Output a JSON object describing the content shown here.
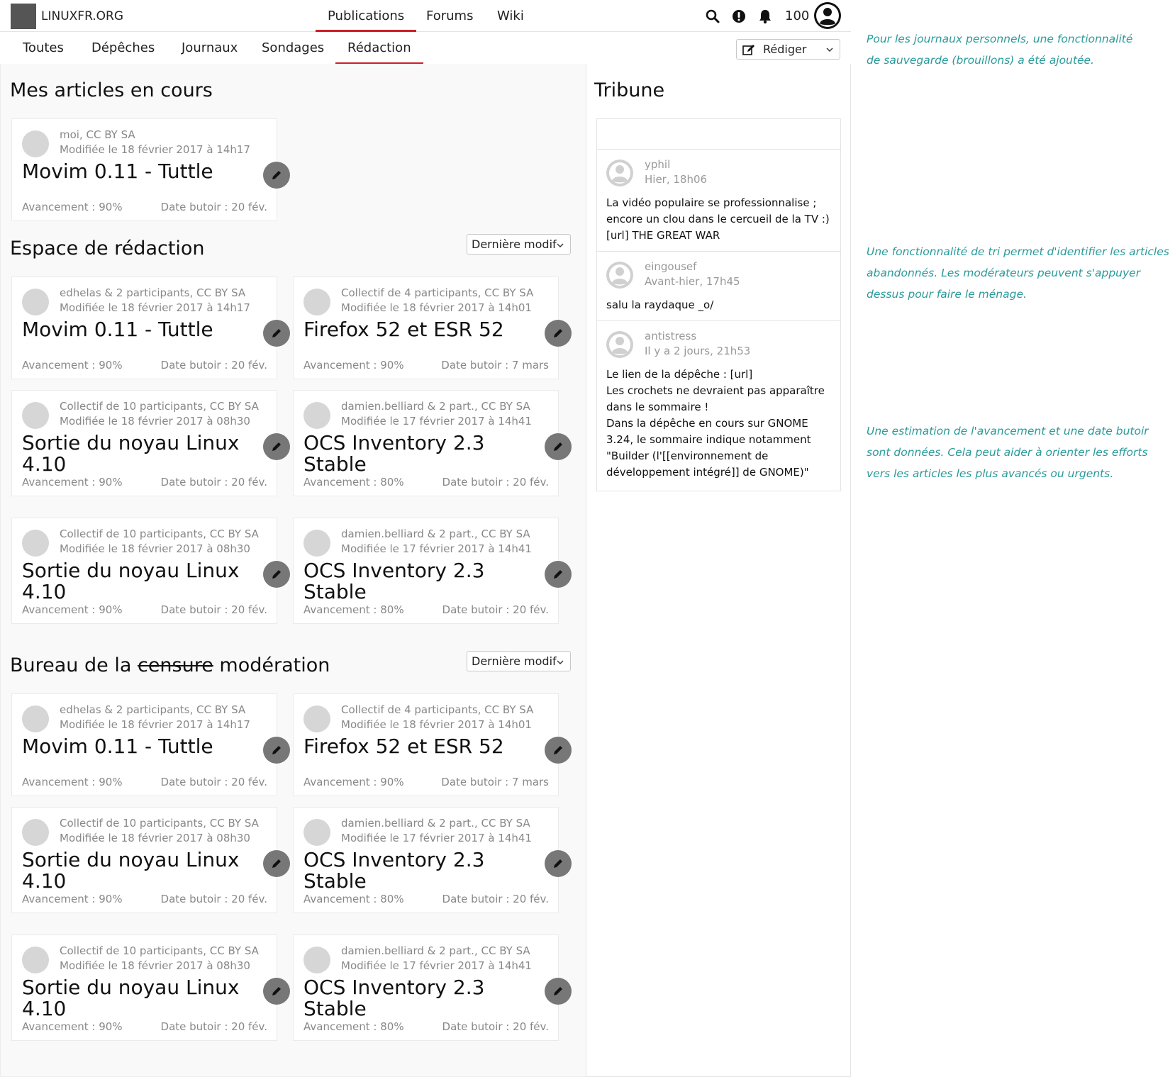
{
  "site": {
    "name": "LINUXFR.ORG"
  },
  "mainnav": [
    {
      "label": "Publications",
      "active": true
    },
    {
      "label": "Forums",
      "active": false
    },
    {
      "label": "Wiki",
      "active": false
    }
  ],
  "toolbar": {
    "score": "100",
    "icons": [
      "search-icon",
      "alert-icon",
      "bell-icon",
      "user-avatar-icon"
    ]
  },
  "subnav": [
    {
      "label": "Toutes",
      "active": false
    },
    {
      "label": "Dépêches",
      "active": false
    },
    {
      "label": "Journaux",
      "active": false
    },
    {
      "label": "Sondages",
      "active": false
    },
    {
      "label": "Rédaction",
      "active": true
    }
  ],
  "write_button": {
    "label": "Rédiger"
  },
  "sections": {
    "mine": {
      "title": "Mes articles en cours",
      "cards": [
        {
          "author": "moi, CC BY SA",
          "modified": "Modifiée le 18 février 2017 à 14h17",
          "title": "Movim 0.11 - Tuttle",
          "progress": "Avancement : 90%",
          "deadline": "Date butoir : 20 fév."
        }
      ]
    },
    "workspace": {
      "title": "Espace de rédaction",
      "sort_label": "Dernière modif",
      "cards": [
        {
          "author": "edhelas & 2 participants, CC BY SA",
          "modified": "Modifiée le 18 février 2017 à 14h17",
          "title": "Movim 0.11 - Tuttle",
          "progress": "Avancement : 90%",
          "deadline": "Date butoir : 20 fév."
        },
        {
          "author": "Collectif de 4 participants, CC BY SA",
          "modified": "Modifiée le 18 février 2017 à 14h01",
          "title": "Firefox 52 et ESR 52",
          "progress": "Avancement : 90%",
          "deadline": "Date butoir : 7 mars"
        },
        {
          "author": "Collectif de 10 participants, CC BY SA",
          "modified": "Modifiée le 18 février 2017 à 08h30",
          "title": "Sortie du noyau Linux 4.10",
          "progress": "Avancement : 90%",
          "deadline": "Date butoir : 20 fév."
        },
        {
          "author": "damien.belliard & 2 part., CC BY SA",
          "modified": "Modifiée le 17 février 2017 à 14h41",
          "title": "OCS Inventory 2.3 Stable",
          "progress": "Avancement : 80%",
          "deadline": "Date butoir : 20 fév."
        },
        {
          "author": "Collectif de 10 participants, CC BY SA",
          "modified": "Modifiée le 18 février 2017 à 08h30",
          "title": "Sortie du noyau Linux 4.10",
          "progress": "Avancement : 90%",
          "deadline": "Date butoir : 20 fév."
        },
        {
          "author": "damien.belliard & 2 part., CC BY SA",
          "modified": "Modifiée le 17 février 2017 à 14h41",
          "title": "OCS Inventory 2.3 Stable",
          "progress": "Avancement : 80%",
          "deadline": "Date butoir : 20 fév."
        }
      ]
    },
    "moderation": {
      "title_prefix": "Bureau de la ",
      "title_struck": "censure",
      "title_suffix": " modération",
      "sort_label": "Dernière modif",
      "cards": [
        {
          "author": "edhelas & 2 participants, CC BY SA",
          "modified": "Modifiée le 18 février 2017 à 14h17",
          "title": "Movim 0.11 - Tuttle",
          "progress": "Avancement : 90%",
          "deadline": "Date butoir : 20 fév."
        },
        {
          "author": "Collectif de 4 participants, CC BY SA",
          "modified": "Modifiée le 18 février 2017 à 14h01",
          "title": "Firefox 52 et ESR 52",
          "progress": "Avancement : 90%",
          "deadline": "Date butoir : 7 mars"
        },
        {
          "author": "Collectif de 10 participants, CC BY SA",
          "modified": "Modifiée le 18 février 2017 à 08h30",
          "title": "Sortie du noyau Linux 4.10",
          "progress": "Avancement : 90%",
          "deadline": "Date butoir : 20 fév."
        },
        {
          "author": "damien.belliard & 2 part., CC BY SA",
          "modified": "Modifiée le 17 février 2017 à 14h41",
          "title": "OCS Inventory 2.3 Stable",
          "progress": "Avancement : 80%",
          "deadline": "Date butoir : 20 fév."
        },
        {
          "author": "Collectif de 10 participants, CC BY SA",
          "modified": "Modifiée le 18 février 2017 à 08h30",
          "title": "Sortie du noyau Linux 4.10",
          "progress": "Avancement : 90%",
          "deadline": "Date butoir : 20 fév."
        },
        {
          "author": "damien.belliard & 2 part., CC BY SA",
          "modified": "Modifiée le 17 février 2017 à 14h41",
          "title": "OCS Inventory 2.3 Stable",
          "progress": "Avancement : 80%",
          "deadline": "Date butoir : 20 fév."
        }
      ]
    }
  },
  "tribune": {
    "title": "Tribune",
    "input_value": "",
    "messages": [
      {
        "author": "yphil",
        "time": "Hier, 18h06",
        "text": "La vidéo populaire se professionnalise ; encore un clou dans le cercueil de la TV :) [url] THE GREAT WAR"
      },
      {
        "author": "eingousef",
        "time": "Avant-hier, 17h45",
        "text": "salu la raydaque _o/"
      },
      {
        "author": "antistress",
        "time": "Il y a 2 jours, 21h53",
        "text": "Le lien de la dépêche : [url]\nLes crochets ne devraient pas apparaître dans le sommaire !\nDans la dépêche en cours sur GNOME 3.24, le sommaire indique notamment \"Builder (l'[[environnement de développement intégré]] de GNOME)\""
      }
    ]
  },
  "annotations": [
    "Pour les journaux personnels, une fonctionnalité de sauvegarde (brouillons) a été ajoutée.",
    "Une fonctionnalité de tri permet d'identifier les articles abandonnés. Les modérateurs peuvent s'appuyer dessus pour faire le ménage.",
    "Une estimation de l'avancement et une date butoir sont données. Cela peut aider à orienter les efforts vers les articles les plus avancés ou urgents."
  ],
  "colors": {
    "accent": "#cc1f26",
    "annotation": "#2a9a9a",
    "muted": "#888888",
    "edit_button": "#777777"
  }
}
